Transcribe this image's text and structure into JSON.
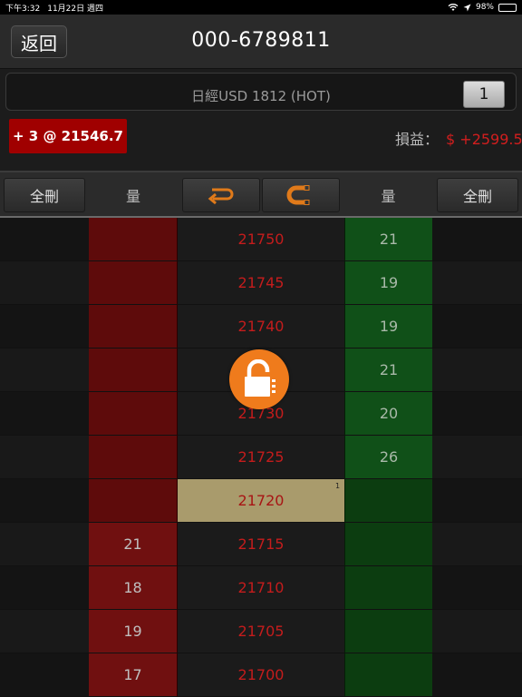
{
  "status_bar": {
    "time": "下午3:32",
    "date": "11月22日 週四",
    "battery": "98%",
    "battery_level": 0.98
  },
  "nav": {
    "back_label": "返回",
    "account": "000-6789811"
  },
  "contract": {
    "name": "日經USD 1812 (HOT)",
    "quantity": "1"
  },
  "position": {
    "badge": "+ 3 @ 21546.7",
    "pnl_label": "損益：",
    "pnl_value": "$ +2599.5"
  },
  "controls": {
    "delete_all_buy": "全刪",
    "buy_volume_header": "量",
    "sell_volume_header": "量",
    "delete_all_sell": "全刪",
    "undo_icon": "return-arrow-icon",
    "magnet_icon": "magnet-icon"
  },
  "ladder": {
    "rows": [
      {
        "price": "21750",
        "buy": "",
        "sell": "21",
        "current": false,
        "mark": ""
      },
      {
        "price": "21745",
        "buy": "",
        "sell": "19",
        "current": false,
        "mark": ""
      },
      {
        "price": "21740",
        "buy": "",
        "sell": "19",
        "current": false,
        "mark": ""
      },
      {
        "price": "",
        "buy": "",
        "sell": "21",
        "current": false,
        "mark": ""
      },
      {
        "price": "21730",
        "buy": "",
        "sell": "20",
        "current": false,
        "mark": ""
      },
      {
        "price": "21725",
        "buy": "",
        "sell": "26",
        "current": false,
        "mark": ""
      },
      {
        "price": "21720",
        "buy": "",
        "sell": "",
        "current": true,
        "mark": "1"
      },
      {
        "price": "21715",
        "buy": "21",
        "sell": "",
        "current": false,
        "mark": ""
      },
      {
        "price": "21710",
        "buy": "18",
        "sell": "",
        "current": false,
        "mark": ""
      },
      {
        "price": "21705",
        "buy": "19",
        "sell": "",
        "current": false,
        "mark": ""
      },
      {
        "price": "21700",
        "buy": "17",
        "sell": "",
        "current": false,
        "mark": ""
      }
    ]
  },
  "overlay": {
    "lock_icon": "unlock-icon",
    "lock_color": "#ef7b1c"
  }
}
